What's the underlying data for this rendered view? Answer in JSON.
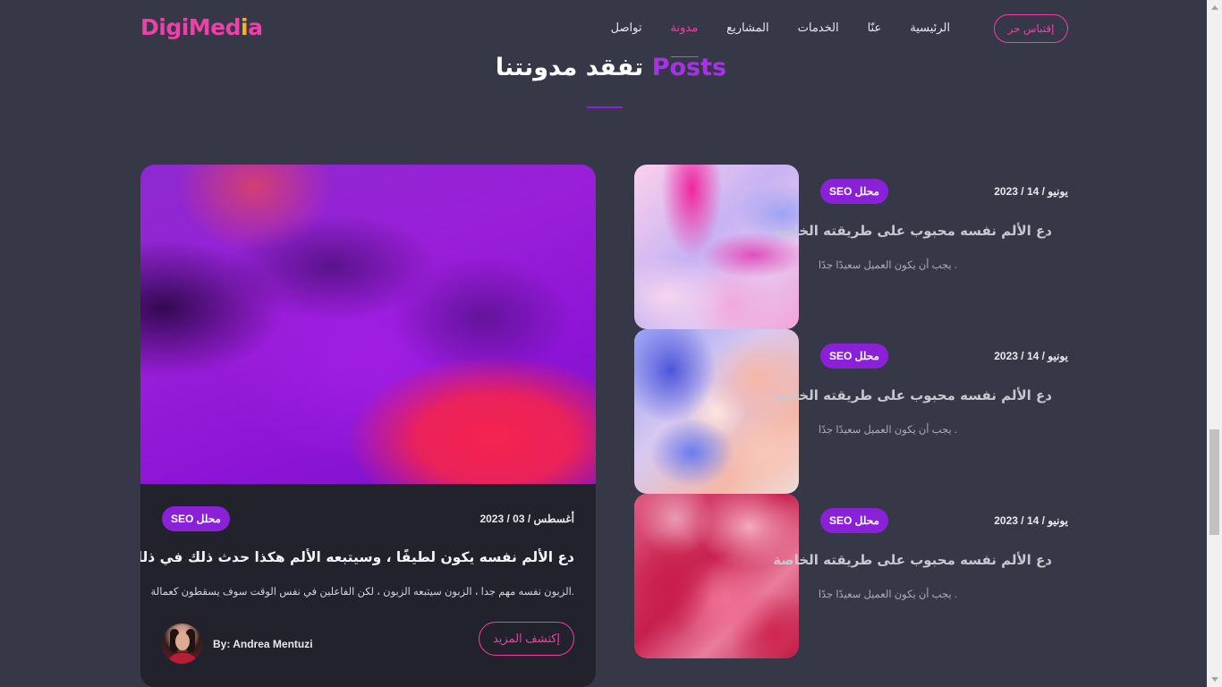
{
  "brand": {
    "name_prefix": "DigiMed",
    "name_accent": "i",
    "name_suffix": "a"
  },
  "nav": {
    "items": [
      {
        "label": "الرئيسية",
        "active": false
      },
      {
        "label": "عنّا",
        "active": false
      },
      {
        "label": "الخدمات",
        "active": false
      },
      {
        "label": "المشاريع",
        "active": false
      },
      {
        "label": "مدونة",
        "active": true
      },
      {
        "label": "تواصل",
        "active": false
      }
    ],
    "cta_label": "إقتباس حر"
  },
  "section": {
    "title_text": "تفقد مدونتنا",
    "title_accent": "Posts"
  },
  "featured": {
    "date": "أغسطس / 03 / 2023",
    "badge": "محلل SEO",
    "title": "دع الألم نفسه يكون لطيفًا ، وسيتبعه الألم هكذا حدث ذلك في ذلك الوقت",
    "description": ".الزبون نفسه مهم جدا ، الزبون سيتبعه الزبون ، لكن الفاعلين في نفس الوقت سوف يسقطون كعمالة",
    "author": "By: Andrea Mentuzi",
    "more_label": "إكتشف المزيد"
  },
  "posts": [
    {
      "date": "يونيو / 14 / 2023",
      "badge": "محلل SEO",
      "title": "دع الألم نفسه محبوب على طريقته الخاصة",
      "description": ". يجب أن يكون العميل سعيدًا جدًا",
      "image": "pink-marble"
    },
    {
      "date": "يونيو / 14 / 2023",
      "badge": "محلل SEO",
      "title": "دع الألم نفسه محبوب على طريقته الخاصة",
      "description": ". يجب أن يكون العميل سعيدًا جدًا",
      "image": "blue-peach-smoke"
    },
    {
      "date": "يونيو / 14 / 2023",
      "badge": "محلل SEO",
      "title": "دع الألم نفسه محبوب على طريقته الخاصة",
      "description": ". يجب أن يكون العميل سعيدًا جدًا",
      "image": "pink-red-smoke"
    }
  ],
  "colors": {
    "background": "#363848",
    "card": "#22222d",
    "accent_pink": "#f03fa6",
    "accent_purple": "#8a21d8",
    "logo_dot": "#f7b32b"
  }
}
